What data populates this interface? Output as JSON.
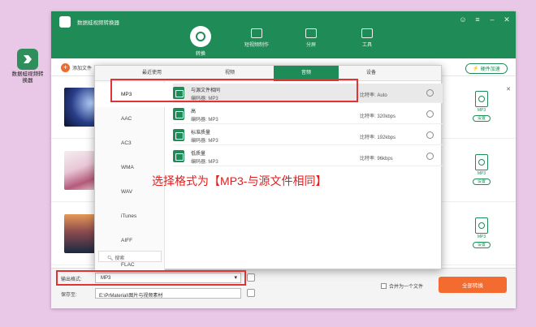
{
  "desktop": {
    "icon_label": "数据蛙视频转换器"
  },
  "app": {
    "title": "数据蛙视频转换器",
    "accent": "#1f8c57",
    "orange": "#f36b2f"
  },
  "nav": {
    "tabs": [
      {
        "label": "转换"
      },
      {
        "label": "短视频制作"
      },
      {
        "label": "分屏"
      },
      {
        "label": "工具"
      }
    ]
  },
  "toolbar": {
    "add_file": "添加文件",
    "hw_accel": "硬件加速"
  },
  "files": [
    {
      "format_caption": "MP3",
      "settings": "设置"
    },
    {
      "format_caption": "MP3",
      "settings": "设置"
    },
    {
      "format_caption": "MP3",
      "settings": "设置"
    }
  ],
  "popup": {
    "tabs": [
      {
        "label": "最近使用"
      },
      {
        "label": "视频"
      },
      {
        "label": "音频"
      },
      {
        "label": "设备"
      }
    ],
    "formats": [
      "MP3",
      "AAC",
      "AC3",
      "WMA",
      "WAV",
      "iTunes",
      "AIFF",
      "FLAC"
    ],
    "search": "搜索",
    "options": [
      {
        "name": "与源文件相同",
        "codec": "编码器:   MP3",
        "rate": "比特率:   Auto"
      },
      {
        "name": "高",
        "codec": "编码器:   MP3",
        "rate": "比特率:   320kbps"
      },
      {
        "name": "标准质量",
        "codec": "编码器:   MP3",
        "rate": "比特率:   192kbps"
      },
      {
        "name": "低质量",
        "codec": "编码器:   MP3",
        "rate": "比特率:   96kbps"
      }
    ]
  },
  "bottom": {
    "output_format_label": "输出格式:",
    "output_format_value": "MP3",
    "save_label": "保存至:",
    "save_path": "E:\\PrMaterial\\图片与视频素材",
    "merge_label": "合并为一个文件",
    "convert_all": "全部转换"
  },
  "annotation": {
    "text": "选择格式为【MP3-与源文件相同】",
    "color": "#e21d1d"
  }
}
